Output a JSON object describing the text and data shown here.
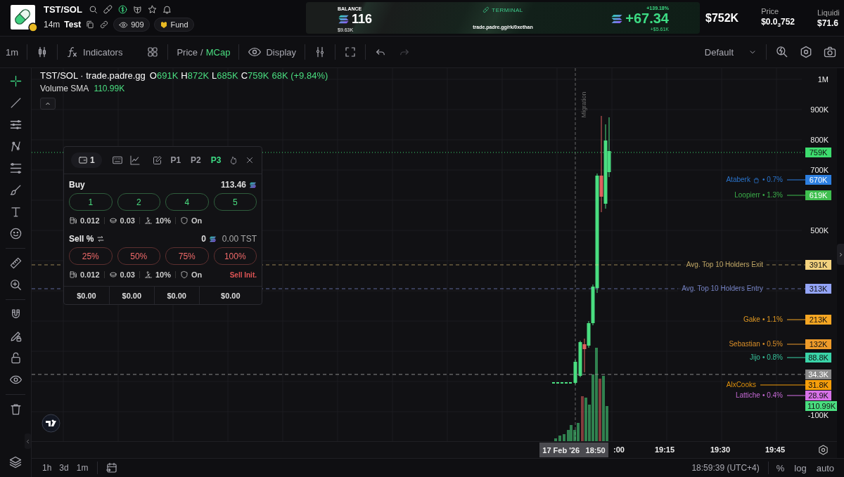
{
  "header": {
    "pair": "TST/SOL",
    "age": "14m",
    "name": "Test",
    "watchers": "909",
    "fund": "Fund"
  },
  "banner": {
    "balance_label": "BALANCE",
    "balance": "116",
    "balance_usd": "$9.63K",
    "brand": "TERMINAL",
    "link": "trade.padre.gg/rk/0xethan",
    "pnl_percent": "+139.18%",
    "pnl": "+67.34",
    "pnl_usd": "+$5.61K"
  },
  "stats": [
    {
      "kind": "big",
      "value": "$752K"
    },
    {
      "kind": "labeled",
      "label": "Price",
      "value": "$0.0$_{3}$752"
    },
    {
      "kind": "labeled",
      "label": "Liquidi",
      "value": "$71.6"
    }
  ],
  "toolbar": {
    "interval": "1m",
    "indicators": "Indicators",
    "modes": [
      {
        "label": "Price",
        "selected": false
      },
      {
        "label": "MCap",
        "selected": true
      }
    ],
    "separator": "/",
    "display": "Display",
    "redo_disabled": true,
    "layout": "Default"
  },
  "tools": [
    {
      "kind": "crosshair",
      "selected": true
    },
    {
      "kind": "trendline",
      "selected": false
    },
    {
      "kind": "hlines",
      "selected": false
    },
    {
      "kind": "nodes",
      "selected": false
    },
    {
      "kind": "fib",
      "selected": false
    },
    {
      "kind": "brush",
      "selected": false
    },
    {
      "kind": "text",
      "selected": false
    },
    {
      "kind": "smiley",
      "selected": false
    },
    {
      "kind": "ruler",
      "selected": false
    },
    {
      "kind": "zoomin",
      "selected": false
    },
    {
      "kind": "magnet",
      "selected": false
    },
    {
      "kind": "pencillock",
      "selected": false
    },
    {
      "kind": "lock",
      "selected": false
    },
    {
      "kind": "eye",
      "selected": false
    },
    {
      "kind": "trash",
      "selected": false
    }
  ],
  "legend": {
    "title": "TST/SOL · trade.padre.gg",
    "ohlc": [
      {
        "key": "O",
        "value": "691K"
      },
      {
        "key": "H",
        "value": "872K"
      },
      {
        "key": "L",
        "value": "685K"
      },
      {
        "key": "C",
        "value": "759K"
      }
    ],
    "change": "68K (+9.84%)",
    "volume_label": "Volume SMA",
    "volume_value": "110.99K"
  },
  "trade_panel": {
    "wallet": "1",
    "presets": [
      {
        "label": "P1",
        "selected": false
      },
      {
        "label": "P2",
        "selected": false
      },
      {
        "label": "P3",
        "selected": true
      }
    ],
    "buy": {
      "label": "Buy",
      "balance": "113.46",
      "amounts": [
        "1",
        "2",
        "4",
        "5"
      ],
      "settings": [
        {
          "kind": "gas",
          "value": "0.012"
        },
        {
          "kind": "priority",
          "value": "0.03"
        },
        {
          "kind": "slippage",
          "value": "10%"
        },
        {
          "kind": "protection",
          "value": "On"
        }
      ]
    },
    "sell": {
      "label": "Sell %",
      "balance": "0",
      "token_balance": "0.00 TST",
      "amounts": [
        "25%",
        "50%",
        "75%",
        "100%"
      ],
      "settings": [
        {
          "kind": "gas",
          "value": "0.012"
        },
        {
          "kind": "priority",
          "value": "0.03"
        },
        {
          "kind": "slippage",
          "value": "10%"
        },
        {
          "kind": "protection",
          "value": "On"
        }
      ],
      "action": "Sell Init."
    },
    "totals": [
      "$0.00",
      "$0.00",
      "$0.00",
      "$0.00"
    ]
  },
  "chart": {
    "marker": "Migration",
    "price_ticks": [
      "1M",
      "900K",
      "800K",
      "700K",
      "500K",
      "-100K"
    ],
    "time_ticks": [
      ":00",
      "19:15",
      "19:30",
      "19:45"
    ],
    "crosshair": {
      "date": "17 Feb '26",
      "time": "18:50"
    },
    "price_lines": [
      {
        "kind": "current",
        "tag": "759K",
        "color": "#3ddc6e"
      },
      {
        "kind": "holder",
        "label": "Ataberk",
        "icon": true,
        "share": "• 0.7%",
        "tag": "670K",
        "color": "#2d7fe0"
      },
      {
        "kind": "holder",
        "label": "Loopierr",
        "icon": false,
        "share": "• 1.3%",
        "tag": "619K",
        "color": "#3fbf4f"
      },
      {
        "kind": "average",
        "label": "Avg. Top 10 Holders Exit",
        "tag": "391K",
        "color": "#f3d27e"
      },
      {
        "kind": "average",
        "label": "Avg. Top 10 Holders Entry",
        "tag": "313K",
        "color": "#93a4f7"
      },
      {
        "kind": "holder",
        "label": "Gake",
        "icon": false,
        "share": "• 1.1%",
        "tag": "213K",
        "color": "#f5a623"
      },
      {
        "kind": "holder",
        "label": "Sebastian",
        "icon": false,
        "share": "• 0.5%",
        "tag": "132K",
        "color": "#ee9b2a"
      },
      {
        "kind": "holder",
        "label": "Jijo",
        "icon": false,
        "share": "• 0.8%",
        "tag": "88.8K",
        "color": "#3ad4a8"
      },
      {
        "kind": "marker",
        "tag": "34.3K",
        "color": "#8a8a8a"
      },
      {
        "kind": "holder",
        "label": "AlxCooks",
        "icon": false,
        "tag": "31.8K",
        "color": "#f59e0b"
      },
      {
        "kind": "holder",
        "label": "Lattiche",
        "icon": false,
        "share": "• 0.4%",
        "tag": "28.9K",
        "color": "#d772e8"
      },
      {
        "kind": "volume",
        "tag": "110.99K",
        "color": "#4ade80"
      }
    ]
  },
  "bottom_bar": {
    "ranges": [
      "1h",
      "3d",
      "1m"
    ],
    "time": "18:59:39 (UTC+4)",
    "options": [
      "%",
      "log",
      "auto"
    ]
  }
}
